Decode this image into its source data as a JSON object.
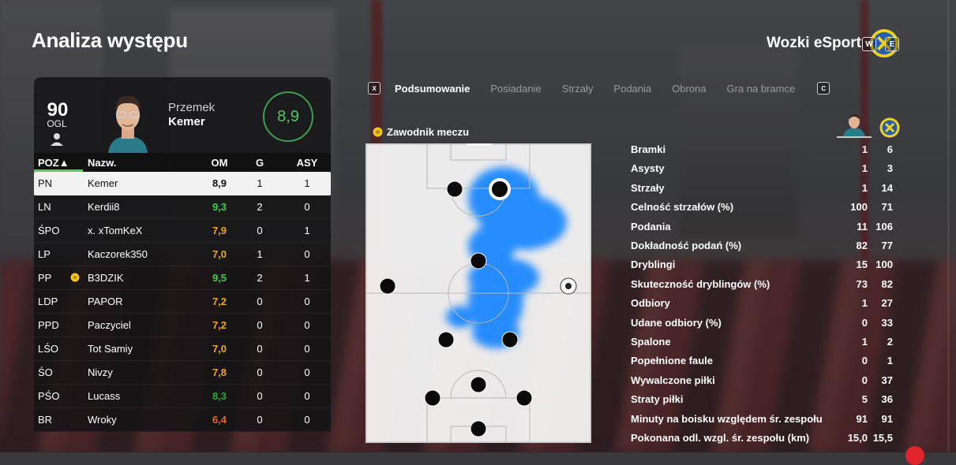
{
  "title": "Analiza występu",
  "team": {
    "name": "Wozki eSport",
    "key_w": "W",
    "key_e": "E"
  },
  "player": {
    "ovr": "90",
    "ovr_label": "OGL",
    "first_name": "Przemek",
    "last_name": "Kemer",
    "rating": "8,9"
  },
  "table": {
    "headers": {
      "pos": "POZ▲",
      "name": "Nazw.",
      "om": "OM",
      "g": "G",
      "a": "ASY"
    },
    "rows": [
      {
        "pos": "PN",
        "name": "Kemer",
        "om": "8,9",
        "g": "1",
        "a": "1",
        "color": "#111111"
      },
      {
        "pos": "LN",
        "name": "Kerdii8",
        "om": "9,3",
        "g": "2",
        "a": "0",
        "color": "#3ad24a"
      },
      {
        "pos": "ŚPO",
        "name": "x. xTomKeX",
        "om": "7,9",
        "g": "0",
        "a": "1",
        "color": "#f2a51e"
      },
      {
        "pos": "LP",
        "name": "Kaczorek350",
        "om": "7,0",
        "g": "1",
        "a": "0",
        "color": "#f2a51e"
      },
      {
        "pos": "PP",
        "name": "B3DZIK",
        "om": "9,5",
        "g": "2",
        "a": "1",
        "color": "#3ad24a"
      },
      {
        "pos": "LDP",
        "name": "PAPOR",
        "om": "7,2",
        "g": "0",
        "a": "0",
        "color": "#f2a51e"
      },
      {
        "pos": "PPD",
        "name": "Paczyciel",
        "om": "7,2",
        "g": "0",
        "a": "0",
        "color": "#f2a51e"
      },
      {
        "pos": "LŚO",
        "name": "Tot Samiy",
        "om": "7,0",
        "g": "0",
        "a": "0",
        "color": "#f2a51e"
      },
      {
        "pos": "ŚO",
        "name": "Nivzy",
        "om": "7,8",
        "g": "0",
        "a": "0",
        "color": "#f2a51e"
      },
      {
        "pos": "PŚO",
        "name": "Lucass",
        "om": "8,3",
        "g": "0",
        "a": "0",
        "color": "#2fa83a"
      },
      {
        "pos": "BR",
        "name": "Wroky",
        "om": "6,4",
        "g": "0",
        "a": "0",
        "color": "#e3692a"
      }
    ]
  },
  "tabs": {
    "key_left": "X",
    "key_right": "C",
    "items": [
      "Podsumowanie",
      "Posiadanie",
      "Strzały",
      "Podania",
      "Obrona",
      "Gra na bramce"
    ]
  },
  "motm_label": "Zawodnik meczu",
  "stats": [
    {
      "label": "Bramki",
      "player": "1",
      "team": "6"
    },
    {
      "label": "Asysty",
      "player": "1",
      "team": "3"
    },
    {
      "label": "Strzały",
      "player": "1",
      "team": "14"
    },
    {
      "label": "Celność strzałów (%)",
      "player": "100",
      "team": "71"
    },
    {
      "label": "Podania",
      "player": "11",
      "team": "106"
    },
    {
      "label": "Dokładność podań (%)",
      "player": "82",
      "team": "77"
    },
    {
      "label": "Dryblingi",
      "player": "15",
      "team": "100"
    },
    {
      "label": "Skuteczność dryblingów (%)",
      "player": "73",
      "team": "82"
    },
    {
      "label": "Odbiory",
      "player": "1",
      "team": "27"
    },
    {
      "label": "Udane odbiory (%)",
      "player": "0",
      "team": "33"
    },
    {
      "label": "Spalone",
      "player": "1",
      "team": "2"
    },
    {
      "label": "Popełnione faule",
      "player": "0",
      "team": "1"
    },
    {
      "label": "Wywalczone piłki",
      "player": "0",
      "team": "37"
    },
    {
      "label": "Straty piłki",
      "player": "5",
      "team": "36"
    },
    {
      "label": "Minuty na boisku względem śr. zespołu",
      "player": "91",
      "team": "91"
    },
    {
      "label": "Pokonana odl. wzgl. śr. zespołu (km)",
      "player": "15,0",
      "team": "15,5"
    }
  ],
  "colors": {
    "accent_green": "#3ad24a",
    "heatmap_blue": "#1e88ff",
    "selected_row": "#f2f2f2"
  }
}
